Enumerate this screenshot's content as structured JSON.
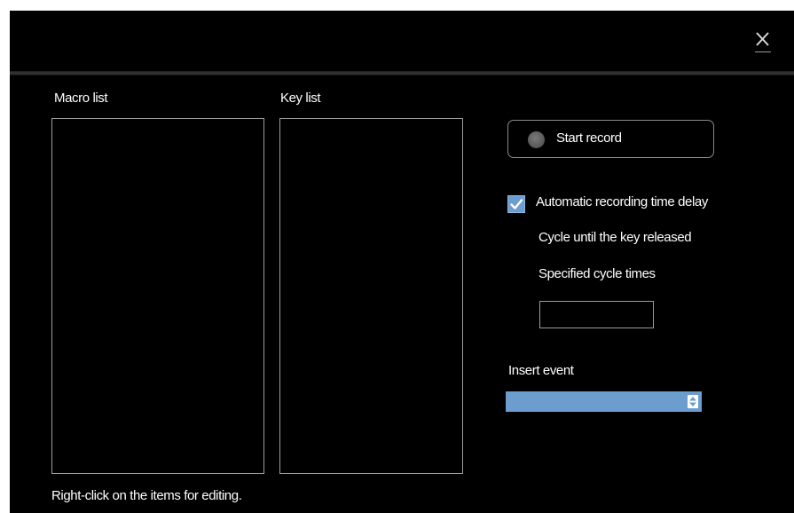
{
  "dialog": {
    "close_icon": "close-icon"
  },
  "macro_list": {
    "label": "Macro list",
    "items": []
  },
  "key_list": {
    "label": "Key list",
    "items": []
  },
  "record": {
    "button_label": "Start record",
    "icon": "record-dot-icon"
  },
  "options": {
    "auto_delay_label": "Automatic recording time delay",
    "auto_delay_checked": true,
    "cycle_until_release_label": "Cycle until the key released",
    "specified_cycle_label": "Specified cycle times",
    "specified_cycle_value": ""
  },
  "insert_event": {
    "label": "Insert event",
    "selected": ""
  },
  "footer": {
    "hint": "Right-click on the items for editing."
  },
  "colors": {
    "background": "#000000",
    "accent": "#6d9ccf",
    "border": "#9c9c9c",
    "text": "#ffffff"
  }
}
